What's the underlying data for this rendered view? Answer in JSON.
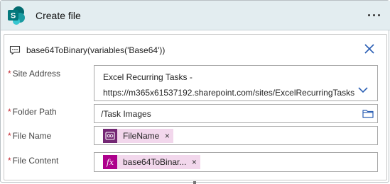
{
  "header": {
    "title": "Create file",
    "logo_letter": "S",
    "more_icon": "ellipsis-icon",
    "colors": {
      "header_bg": "#e3edf0",
      "logo_dark": "#036c70",
      "logo_light": "#1a9ba1"
    }
  },
  "note": {
    "icon": "comment-icon",
    "text": "base64ToBinary(variables('Base64'))",
    "close_icon": "close-icon",
    "close_color": "#2b5fb4"
  },
  "fields": {
    "site_address": {
      "required_mark": "*",
      "label": "Site Address",
      "value_line1": "Excel Recurring Tasks -",
      "value_line2": "https://m365x61537192.sharepoint.com/sites/ExcelRecurringTasks",
      "icon": "chevron-down-icon"
    },
    "folder_path": {
      "required_mark": "*",
      "label": "Folder Path",
      "value": "/Task Images",
      "icon": "folder-icon"
    },
    "file_name": {
      "required_mark": "*",
      "label": "File Name",
      "token_label": "FileName",
      "token_icon": "power-apps-icon",
      "remove": "×",
      "token_color": "#742774"
    },
    "file_content": {
      "required_mark": "*",
      "label": "File Content",
      "token_label": "base64ToBinar...",
      "token_icon": "fx-icon",
      "token_icon_text": "fx",
      "remove": "×",
      "token_color": "#ad008c"
    }
  }
}
